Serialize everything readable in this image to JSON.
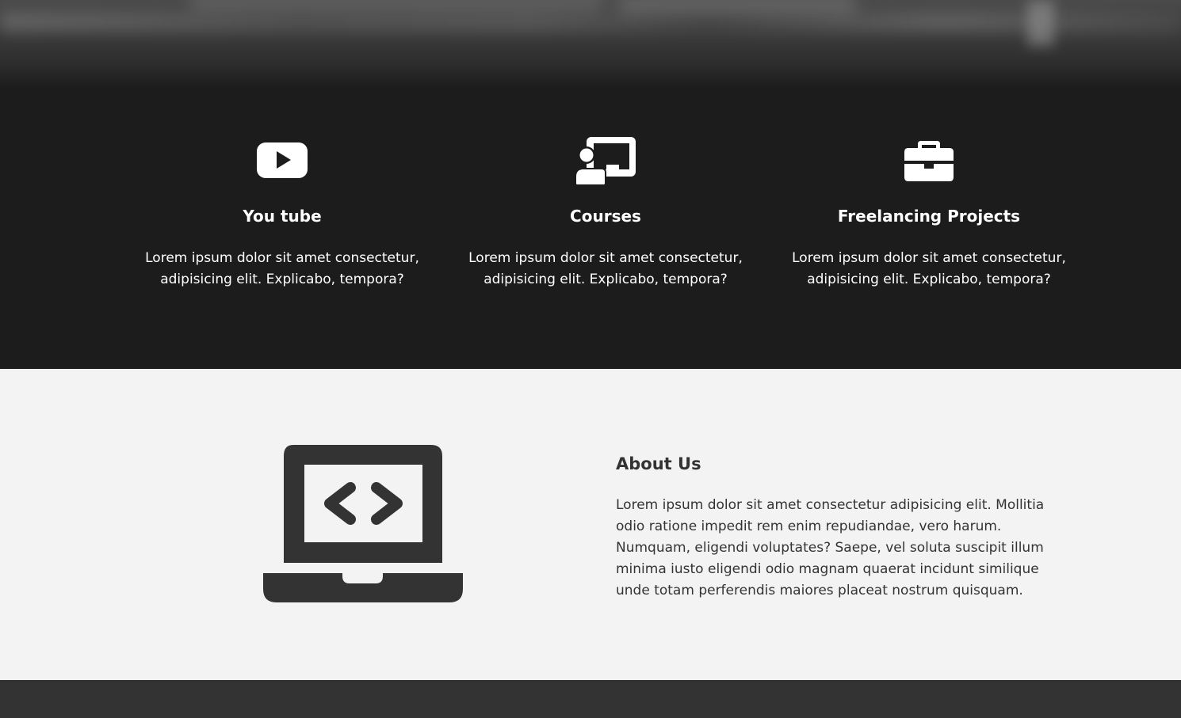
{
  "services": [
    {
      "icon": "youtube-icon",
      "title": "You tube",
      "text": "Lorem ipsum dolor sit amet consectetur, adipisicing elit. Explicabo, tempora?"
    },
    {
      "icon": "chalkboard-teacher-icon",
      "title": "Courses",
      "text": "Lorem ipsum dolor sit amet consectetur, adipisicing elit. Explicabo, tempora?"
    },
    {
      "icon": "briefcase-icon",
      "title": "Freelancing Projects",
      "text": "Lorem ipsum dolor sit amet consectetur, adipisicing elit. Explicabo, tempora?"
    }
  ],
  "about": {
    "icon": "laptop-code-icon",
    "heading": "About Us",
    "text": "Lorem ipsum dolor sit amet consectetur adipisicing elit. Mollitia odio ratione impedit rem enim repudiandae, vero harum. Numquam, eligendi voluptates? Saepe, vel soluta suscipit illum minima iusto eligendi odio magnam quaerat incidunt similique unde totam perferendis maiores placeat nostrum quisquam."
  },
  "colors": {
    "services_background": "#1c1c1c",
    "about_background": "#f3f3f3",
    "footer_background": "#333333",
    "text_light": "#ffffff",
    "text_dark": "#333333"
  }
}
